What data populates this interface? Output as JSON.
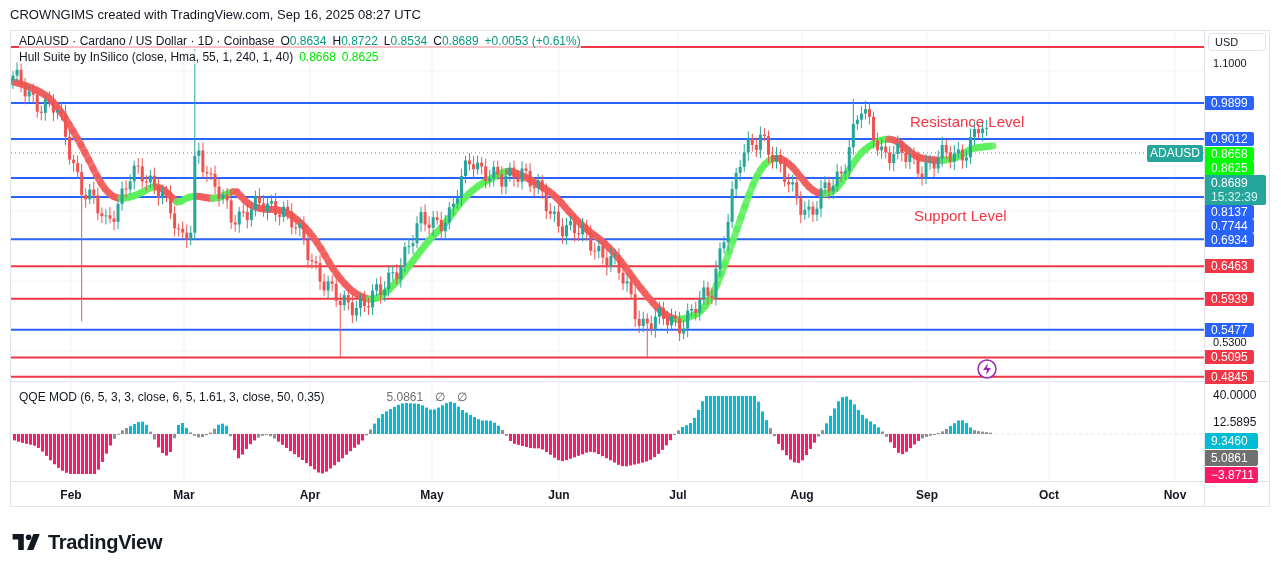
{
  "header": {
    "text": "CROWNGIMS created with TradingView.com, Sep 16, 2025 08:27 UTC"
  },
  "legend": {
    "symbol": "ADAUSD · Cardano / US Dollar · 1D · Coinbase",
    "ohlc": [
      {
        "key": "O",
        "value": "0.8634"
      },
      {
        "key": "H",
        "value": "0.8722"
      },
      {
        "key": "L",
        "value": "0.8534"
      },
      {
        "key": "C",
        "value": "0.8689"
      }
    ],
    "change": "+0.0053 (+0.61%)"
  },
  "hull": {
    "name": "Hull Suite by InSilico (close, Hma, 55, 1, 240, 1, 40)",
    "values": [
      "0.8668",
      "0.8625"
    ]
  },
  "annotations": [
    {
      "text": "Resistance Level"
    },
    {
      "text": "Support Level"
    }
  ],
  "currency": "USD",
  "price_ticks": [
    "1.1000",
    "0.5300"
  ],
  "levels": [
    {
      "kind": "level",
      "label": "0.9899",
      "color": "#2962ff"
    },
    {
      "kind": "level",
      "label": "0.9012",
      "color": "#2962ff"
    },
    {
      "kind": "indicator",
      "label": "0.8668",
      "color": "#00ff00"
    },
    {
      "kind": "indicator",
      "label": "0.8625",
      "color": "#00ff00"
    },
    {
      "kind": "level",
      "label": "0.8137",
      "color": "#2962ff"
    },
    {
      "kind": "level",
      "label": "0.7744",
      "color": "#2962ff"
    },
    {
      "kind": "level",
      "label": "0.6934",
      "color": "#2962ff"
    },
    {
      "kind": "level",
      "label": "0.6463",
      "color": "#f23645"
    },
    {
      "kind": "level",
      "label": "0.5939",
      "color": "#f23645"
    },
    {
      "kind": "level",
      "label": "0.5477",
      "color": "#2962ff"
    },
    {
      "kind": "level",
      "label": "0.5095",
      "color": "#f23645"
    },
    {
      "kind": "level",
      "label": "0.4845",
      "color": "#f23645"
    }
  ],
  "last_price": {
    "symbol": "ADAUSD",
    "price": "0.8689",
    "countdown": "15:32:39"
  },
  "oscillator": {
    "name": "QQE MOD (6, 5, 3, 3, close, 6, 5, 1.61, 3, close, 50, 0.35)",
    "value": "5.0861",
    "symbols": [
      "∅",
      "∅"
    ],
    "ticks": [
      "40.0000",
      "12.5895"
    ],
    "labels": [
      {
        "label": "9.3460",
        "color": "#00bcd4"
      },
      {
        "label": "5.0861",
        "color": "#707070"
      },
      {
        "label": "−3.8711",
        "color": "#ff1a66"
      }
    ]
  },
  "months": [
    "Feb",
    "Mar",
    "Apr",
    "May",
    "Jun",
    "Jul",
    "Aug",
    "Sep",
    "Oct",
    "Nov"
  ],
  "brand": "TradingView"
}
